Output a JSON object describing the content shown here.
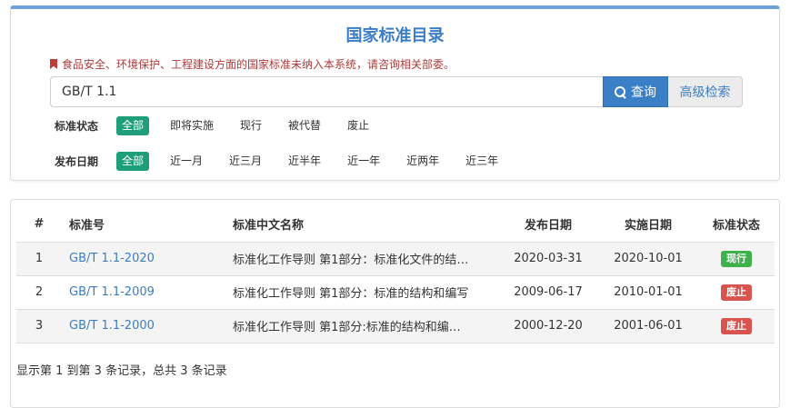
{
  "header": {
    "title": "国家标准目录",
    "notice": "食品安全、环境保护、工程建设方面的国家标准未纳入本系统，请咨询相关部委。"
  },
  "search": {
    "value": "GB/T 1.1",
    "button_label": "查询",
    "advanced_label": "高级检索"
  },
  "filters": {
    "status": {
      "label": "标准状态",
      "options": [
        "全部",
        "即将实施",
        "现行",
        "被代替",
        "废止"
      ],
      "selected": "全部"
    },
    "date": {
      "label": "发布日期",
      "options": [
        "全部",
        "近一月",
        "近三月",
        "近半年",
        "近一年",
        "近两年",
        "近三年"
      ],
      "selected": "全部"
    }
  },
  "table": {
    "headers": [
      "#",
      "标准号",
      "标准中文名称",
      "发布日期",
      "实施日期",
      "标准状态"
    ],
    "rows": [
      {
        "idx": "1",
        "code": "GB/T 1.1-2020",
        "name": "标准化工作导则 第1部分：标准化文件的结…",
        "pub": "2020-03-31",
        "imp": "2020-10-01",
        "status": "现行"
      },
      {
        "idx": "2",
        "code": "GB/T 1.1-2009",
        "name": "标准化工作导则 第1部分：标准的结构和编写",
        "pub": "2009-06-17",
        "imp": "2010-01-01",
        "status": "废止"
      },
      {
        "idx": "3",
        "code": "GB/T 1.1-2000",
        "name": "标准化工作导则 第1部分:标准的结构和编…",
        "pub": "2000-12-20",
        "imp": "2001-06-01",
        "status": "废止"
      }
    ],
    "summary": "显示第 1 到第 3 条记录，总共 3 条记录"
  },
  "colors": {
    "accent": "#3b80c6",
    "active_chip": "#1f9e7c",
    "status_current": "#3eb14a",
    "status_abolished": "#d9534f",
    "notice": "#b03a3a"
  }
}
